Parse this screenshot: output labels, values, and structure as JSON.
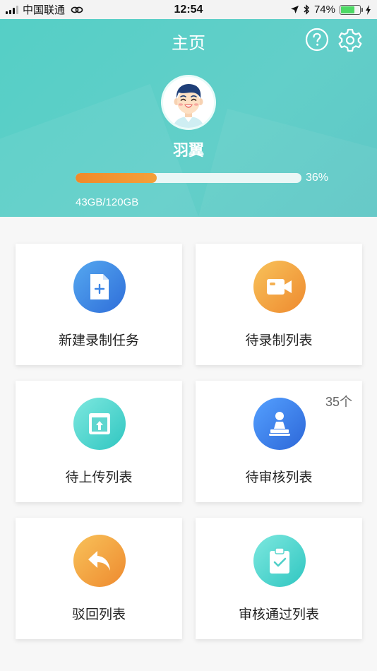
{
  "status_bar": {
    "carrier": "中国联通",
    "time": "12:54",
    "battery_percent": "74%",
    "battery_level": 0.74,
    "icons": [
      "signal-icon",
      "link-icon",
      "location-arrow-icon",
      "bluetooth-icon",
      "battery-icon",
      "charging-icon"
    ]
  },
  "header": {
    "title": "主页",
    "help_icon": "question-circle-icon",
    "settings_icon": "gear-icon",
    "username": "羽翼",
    "storage": {
      "percent_text": "36%",
      "percent_value": 36,
      "used_total_text": "43GB/120GB"
    }
  },
  "grid": {
    "items": [
      {
        "label": "新建录制任务",
        "icon": "new-document-icon",
        "color": "#3d86e6",
        "badge": ""
      },
      {
        "label": "待录制列表",
        "icon": "video-camera-icon",
        "color": "#f2a03c",
        "badge": ""
      },
      {
        "label": "待上传列表",
        "icon": "upload-image-icon",
        "color": "#3fcac4",
        "badge": ""
      },
      {
        "label": "待审核列表",
        "icon": "stamp-icon",
        "color": "#3574e0",
        "badge": "35个"
      },
      {
        "label": "驳回列表",
        "icon": "reply-arrow-icon",
        "color": "#f2a03c",
        "badge": ""
      },
      {
        "label": "审核通过列表",
        "icon": "clipboard-check-icon",
        "color": "#3fcac4",
        "badge": ""
      }
    ]
  }
}
